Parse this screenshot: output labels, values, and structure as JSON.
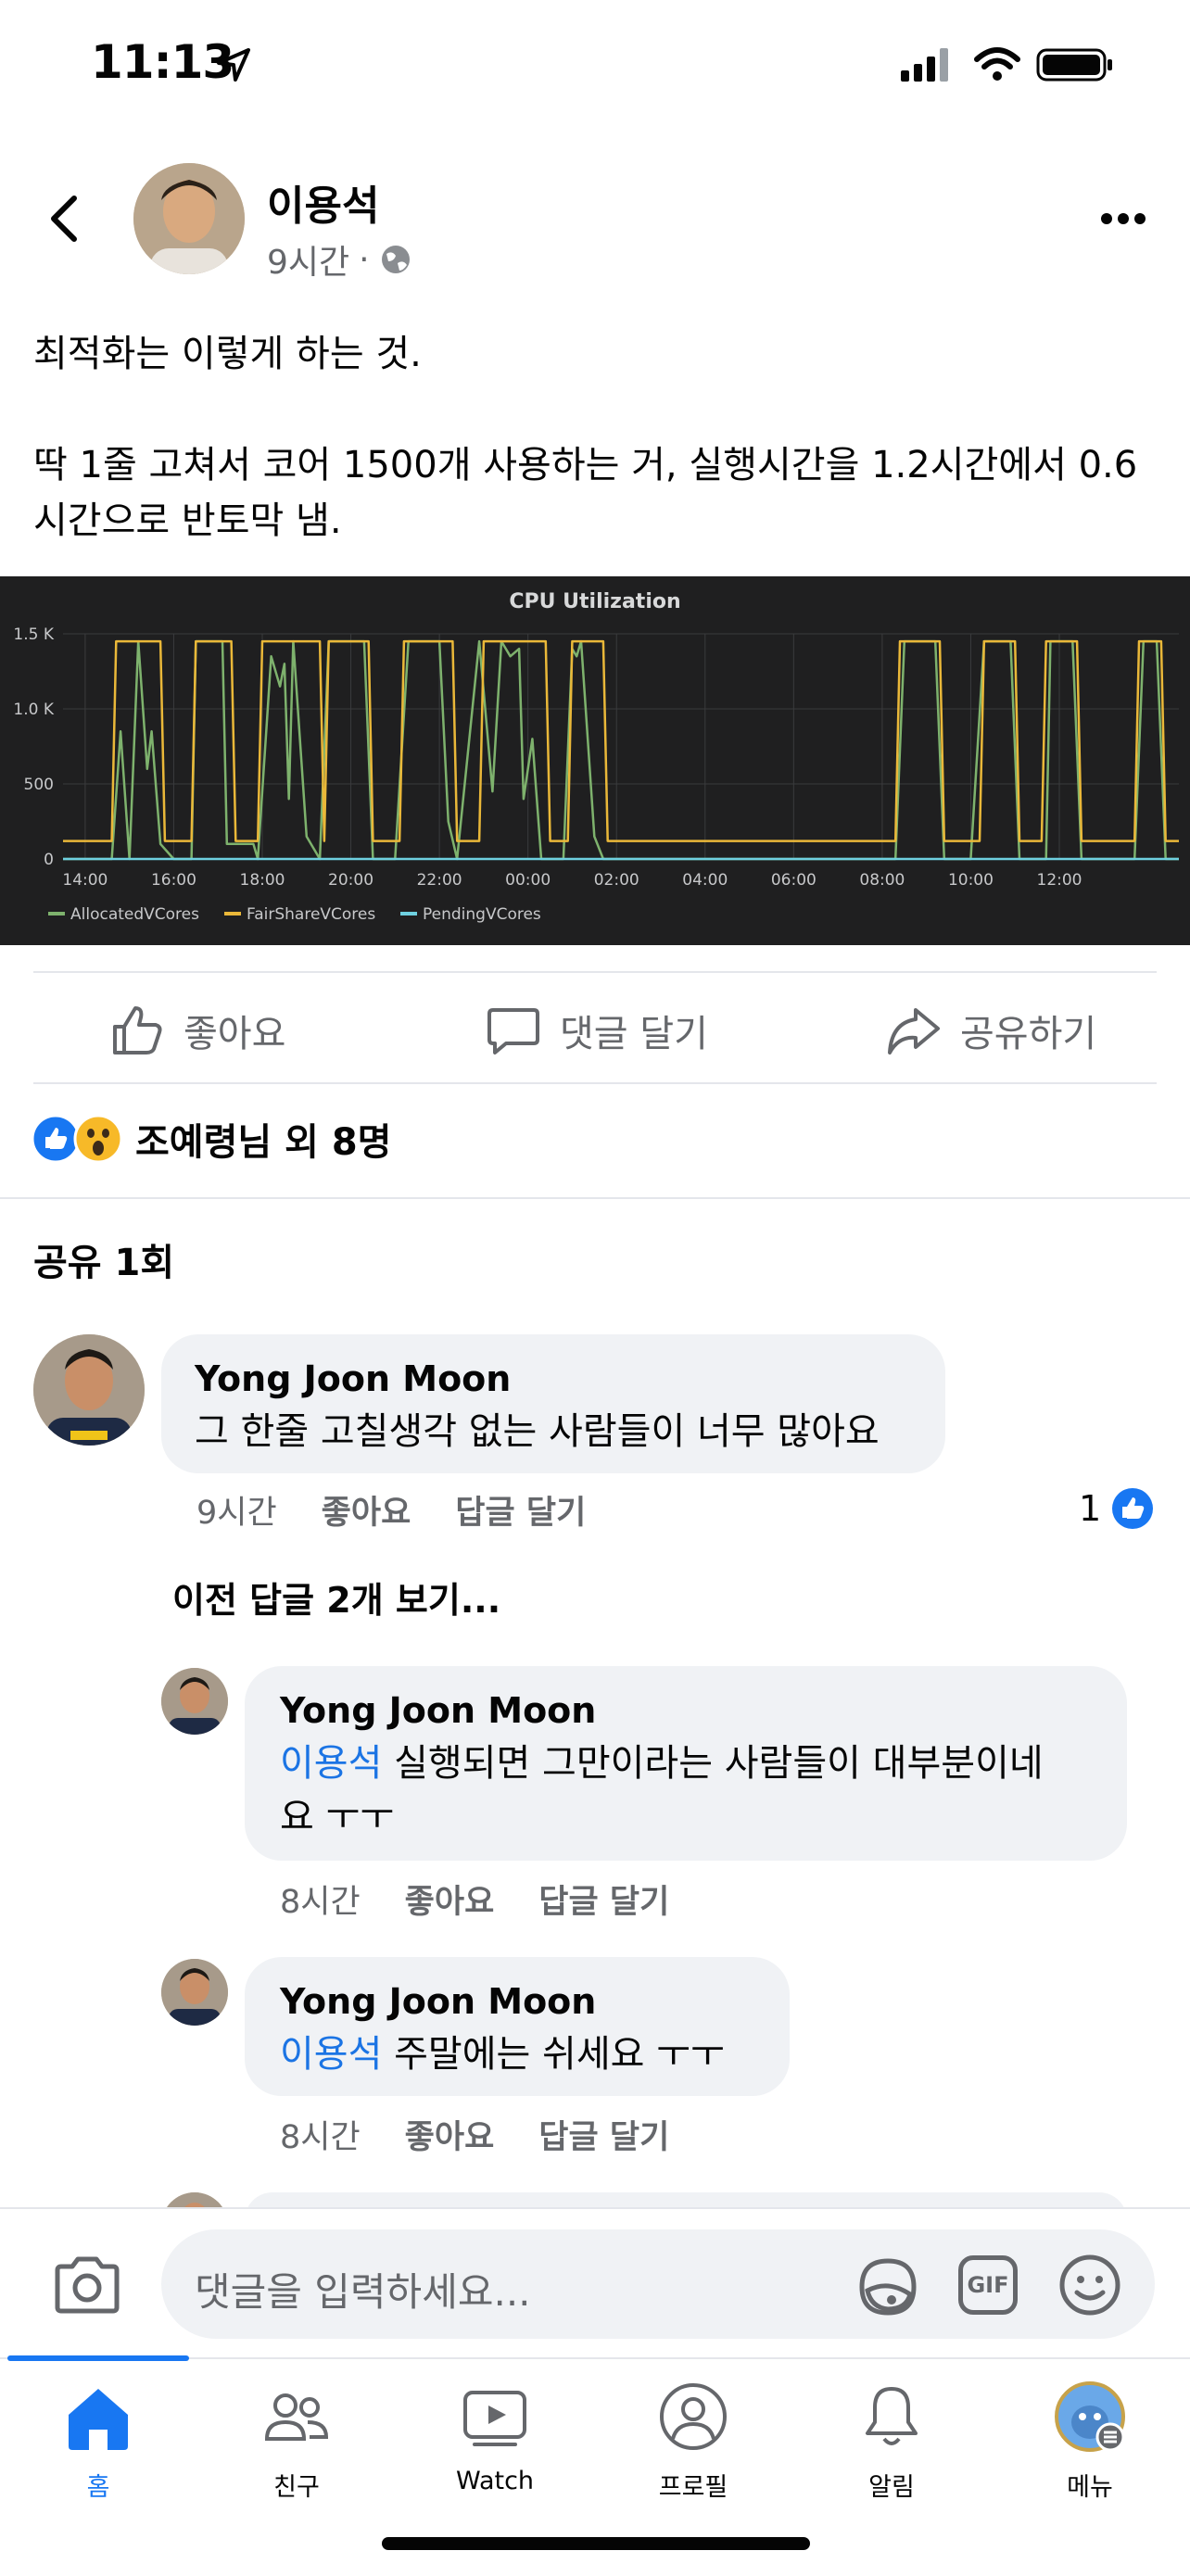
{
  "status_bar": {
    "time": "11:13"
  },
  "post": {
    "author": "이용석",
    "time": "9시간",
    "text": "최적화는 이렇게 하는 것.\n\n딱 1줄 고쳐서 코어 1500개 사용하는 거, 실행시간을 1.2시간에서 0.6시간으로 반토막 냄."
  },
  "chart_data": {
    "type": "line",
    "title": "CPU Utilization",
    "x_ticks": [
      "14:00",
      "16:00",
      "18:00",
      "20:00",
      "22:00",
      "00:00",
      "02:00",
      "04:00",
      "06:00",
      "08:00",
      "10:00",
      "12:00"
    ],
    "y_ticks": [
      "0",
      "500",
      "1.0 K",
      "1.5 K"
    ],
    "ylim": [
      0,
      1500
    ],
    "xlim_hours": [
      13.5,
      38.7
    ],
    "legend_position": "bottom-left",
    "grid": true,
    "series": [
      {
        "name": "AllocatedVCores",
        "color": "#7eb26d",
        "points": [
          [
            13.5,
            0
          ],
          [
            14.6,
            0
          ],
          [
            14.8,
            850
          ],
          [
            15.0,
            0
          ],
          [
            15.2,
            1450
          ],
          [
            15.4,
            600
          ],
          [
            15.5,
            850
          ],
          [
            15.7,
            100
          ],
          [
            16.0,
            0
          ],
          [
            16.4,
            0
          ],
          [
            16.5,
            1450
          ],
          [
            17.1,
            1450
          ],
          [
            17.2,
            100
          ],
          [
            17.8,
            100
          ],
          [
            17.9,
            0
          ],
          [
            18.2,
            1350
          ],
          [
            18.4,
            1150
          ],
          [
            18.5,
            1300
          ],
          [
            18.6,
            400
          ],
          [
            18.7,
            1450
          ],
          [
            19.0,
            150
          ],
          [
            19.3,
            0
          ],
          [
            19.5,
            1450
          ],
          [
            20.3,
            1450
          ],
          [
            20.5,
            0
          ],
          [
            21.0,
            0
          ],
          [
            21.3,
            1450
          ],
          [
            22.0,
            1450
          ],
          [
            22.2,
            250
          ],
          [
            22.4,
            0
          ],
          [
            22.9,
            1450
          ],
          [
            23.2,
            450
          ],
          [
            23.4,
            1450
          ],
          [
            23.6,
            1350
          ],
          [
            23.8,
            1400
          ],
          [
            23.9,
            400
          ],
          [
            24.1,
            800
          ],
          [
            24.3,
            0
          ],
          [
            24.8,
            0
          ],
          [
            25.0,
            1400
          ],
          [
            25.1,
            1350
          ],
          [
            25.2,
            1450
          ],
          [
            25.5,
            150
          ],
          [
            25.7,
            0
          ],
          [
            32.3,
            0
          ],
          [
            32.5,
            1450
          ],
          [
            33.2,
            1450
          ],
          [
            33.4,
            0
          ],
          [
            34.0,
            0
          ],
          [
            34.3,
            1450
          ],
          [
            34.9,
            1450
          ],
          [
            35.1,
            0
          ],
          [
            35.7,
            0
          ],
          [
            35.8,
            1450
          ],
          [
            36.3,
            1450
          ],
          [
            36.5,
            0
          ],
          [
            37.7,
            0
          ],
          [
            37.9,
            1450
          ],
          [
            38.2,
            1450
          ],
          [
            38.4,
            0
          ],
          [
            38.7,
            0
          ]
        ]
      },
      {
        "name": "FairShareVCores",
        "color": "#eab839",
        "points": [
          [
            13.5,
            120
          ],
          [
            14.6,
            120
          ],
          [
            14.7,
            1450
          ],
          [
            15.7,
            1450
          ],
          [
            15.8,
            120
          ],
          [
            16.4,
            120
          ],
          [
            16.5,
            1450
          ],
          [
            17.3,
            1450
          ],
          [
            17.4,
            120
          ],
          [
            17.9,
            120
          ],
          [
            18.0,
            1450
          ],
          [
            19.3,
            1450
          ],
          [
            19.4,
            120
          ],
          [
            19.5,
            1450
          ],
          [
            20.4,
            1450
          ],
          [
            20.5,
            120
          ],
          [
            21.1,
            120
          ],
          [
            21.2,
            1450
          ],
          [
            22.3,
            1450
          ],
          [
            22.4,
            120
          ],
          [
            22.9,
            120
          ],
          [
            23.0,
            1450
          ],
          [
            24.4,
            1450
          ],
          [
            24.5,
            120
          ],
          [
            24.9,
            120
          ],
          [
            25.0,
            1450
          ],
          [
            25.7,
            1450
          ],
          [
            25.8,
            120
          ],
          [
            32.3,
            120
          ],
          [
            32.4,
            1450
          ],
          [
            33.3,
            1450
          ],
          [
            33.4,
            120
          ],
          [
            34.2,
            120
          ],
          [
            34.3,
            1450
          ],
          [
            35.0,
            1450
          ],
          [
            35.1,
            120
          ],
          [
            35.6,
            120
          ],
          [
            35.7,
            1450
          ],
          [
            36.4,
            1450
          ],
          [
            36.5,
            120
          ],
          [
            37.7,
            120
          ],
          [
            37.8,
            1450
          ],
          [
            38.3,
            1450
          ],
          [
            38.4,
            120
          ],
          [
            38.7,
            120
          ]
        ]
      },
      {
        "name": "PendingVCores",
        "color": "#6ed0e0",
        "points": [
          [
            13.5,
            0
          ],
          [
            38.7,
            0
          ]
        ]
      }
    ]
  },
  "actions": {
    "like": "좋아요",
    "comment": "댓글 달기",
    "share": "공유하기"
  },
  "reactions": {
    "text": "조예령님 외 8명"
  },
  "shares": {
    "text": "공유 1회"
  },
  "comments": [
    {
      "name": "Yong Joon Moon",
      "text": "그 한줄 고칠생각 없는 사람들이 너무 많아요",
      "time": "9시간",
      "like": "좋아요",
      "reply": "답글 달기",
      "like_count": "1"
    }
  ],
  "prev_replies": "이전 답글 2개 보기...",
  "replies": [
    {
      "name": "Yong Joon Moon",
      "mention": "이용석",
      "text_line1": " 실행되면 그만이라는 사람들이 대부분이네",
      "text_line2": "요 ㅜㅜ",
      "time": "8시간",
      "like": "좋아요",
      "reply": "답글 달기"
    },
    {
      "name": "Yong Joon Moon",
      "mention": "이용석",
      "text": " 주말에는 쉬세요 ㅜㅜ",
      "time": "8시간",
      "like": "좋아요",
      "reply": "답글 달기"
    }
  ],
  "composer": {
    "placeholder": "댓글을 입력하세요...",
    "gif": "GIF"
  },
  "tabs": [
    {
      "label": "홈",
      "icon": "home-icon",
      "active": true
    },
    {
      "label": "친구",
      "icon": "friends-icon"
    },
    {
      "label": "Watch",
      "icon": "watch-icon"
    },
    {
      "label": "프로필",
      "icon": "profile-icon"
    },
    {
      "label": "알림",
      "icon": "bell-icon"
    },
    {
      "label": "메뉴",
      "icon": "menu-avatar-icon"
    }
  ],
  "colors": {
    "accent": "#1877f2",
    "mention": "#1b74e4",
    "secondary_text": "#65676b"
  }
}
